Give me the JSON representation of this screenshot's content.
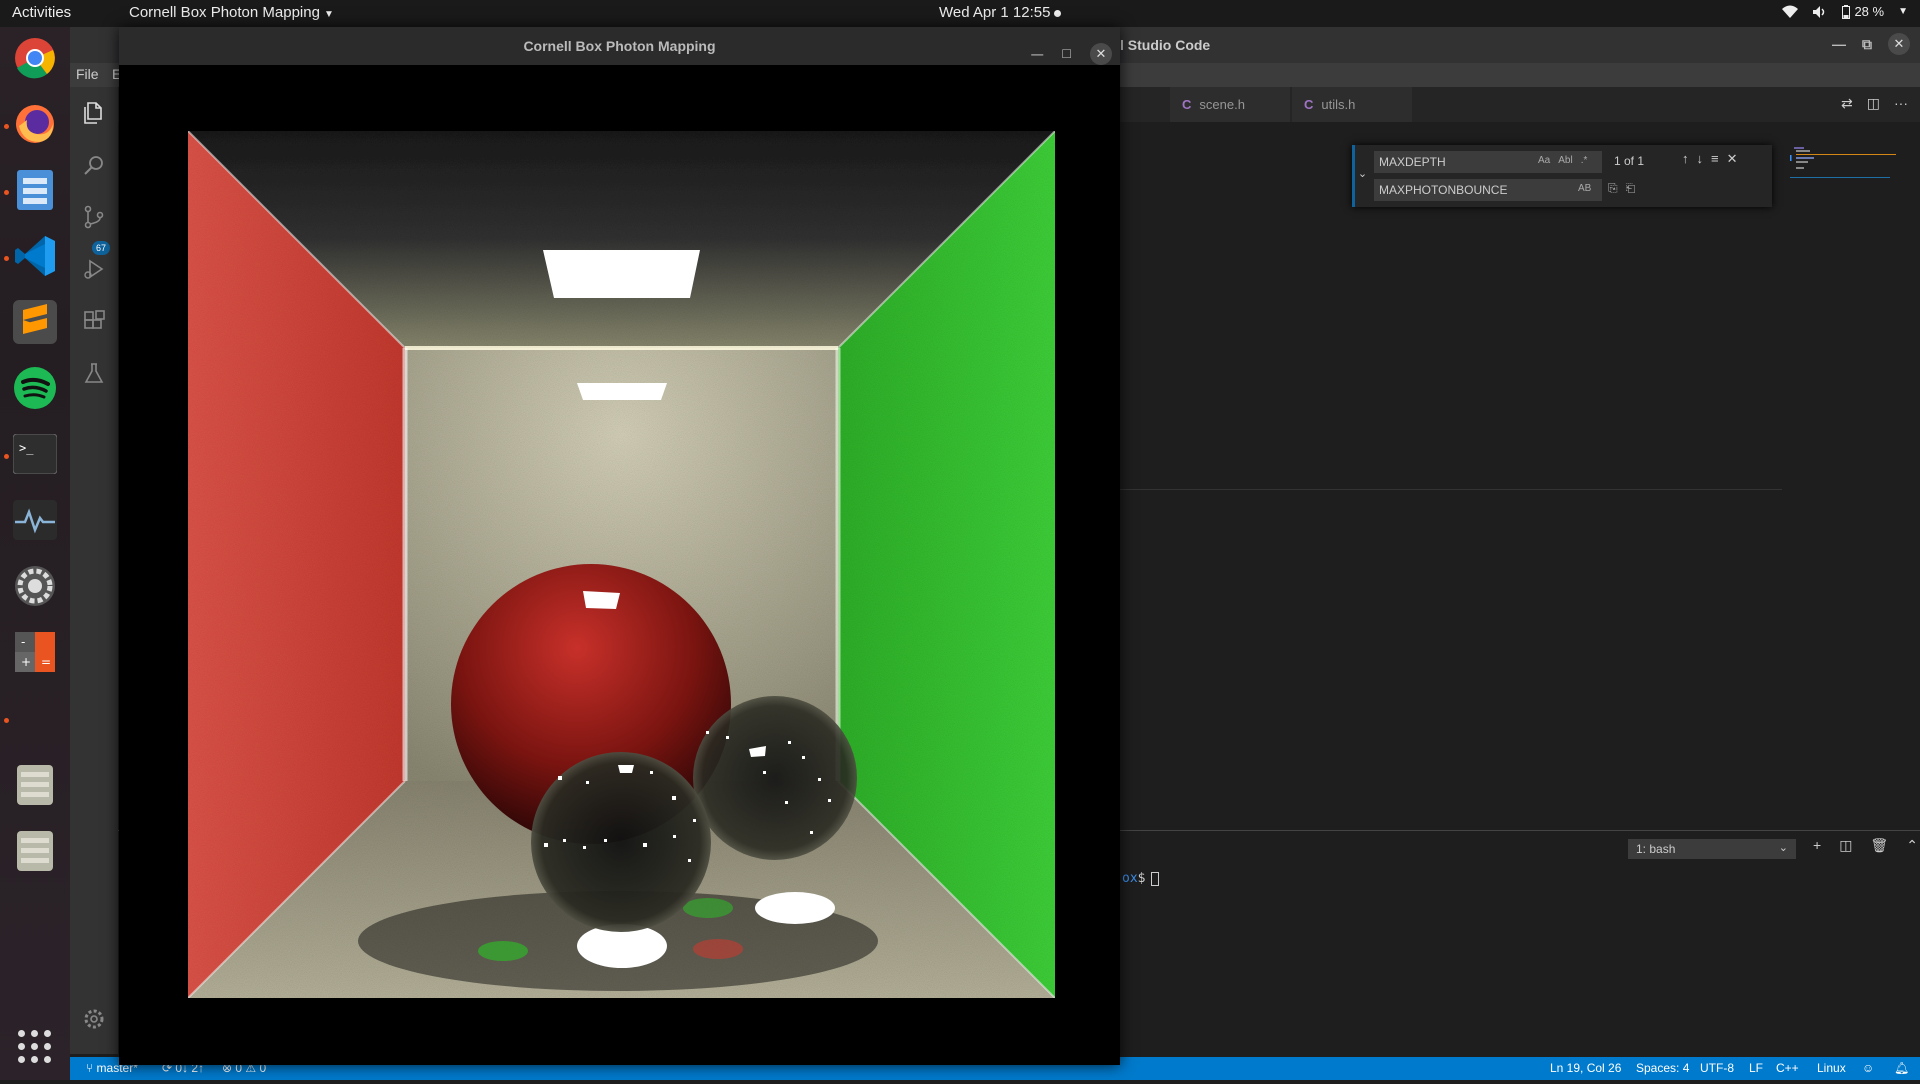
{
  "topbar": {
    "activities": "Activities",
    "app_menu": "Cornell Box Photon Mapping",
    "clock": "Wed Apr 1  12:55",
    "battery": "28 %"
  },
  "vscode": {
    "title": "l Studio Code",
    "menu": {
      "file": "File",
      "edit": "E"
    },
    "tabs": [
      {
        "label": "scene.h",
        "lang": "C"
      },
      {
        "label": "utils.h",
        "lang": "C"
      }
    ],
    "scm_badge": "67",
    "find": {
      "search_value": "MAXDEPTH",
      "replace_value": "MAXPHOTONBOUNCE",
      "match_case": "Aa",
      "whole_word": "Abl",
      "regex": ".*",
      "preserve_case": "AB",
      "count": "1 of 1"
    },
    "terminal": {
      "selected": "1: bash",
      "prompt_path": "ox",
      "prompt_symbol": "$"
    },
    "statusbar": {
      "branch": "master*",
      "sync": "0↓ 2↑",
      "problems": "⊗ 0 ⚠ 0",
      "position": "Ln 19, Col 26",
      "spaces": "Spaces: 4",
      "encoding": "UTF-8",
      "eol": "LF",
      "language": "C++",
      "platform": "Linux"
    }
  },
  "render_window": {
    "title": "Cornell Box Photon Mapping"
  },
  "colors": {
    "accent": "#007acc",
    "ubuntu_orange": "#e95420",
    "left_wall": "#c0392b",
    "right_wall": "#2ecc40"
  }
}
